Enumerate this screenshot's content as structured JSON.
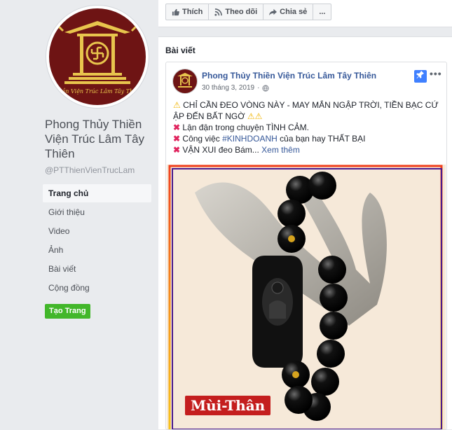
{
  "page": {
    "name": "Phong Thủy Thiền Viện Trúc Lâm Tây Thiên",
    "handle": "@PTThienVienTrucLam",
    "logo_text": "Thiền Viện Trúc Lâm Tây Thiên"
  },
  "nav": {
    "items": [
      {
        "label": "Trang chủ",
        "active": true
      },
      {
        "label": "Giới thiệu"
      },
      {
        "label": "Video"
      },
      {
        "label": "Ảnh"
      },
      {
        "label": "Bài viết"
      },
      {
        "label": "Cộng đồng"
      }
    ],
    "create_page_label": "Tạo Trang"
  },
  "actions": {
    "like": "Thích",
    "follow": "Theo dõi",
    "share": "Chia sẻ",
    "more": "..."
  },
  "posts_section": {
    "title": "Bài viết"
  },
  "post": {
    "author": "Phong Thủy Thiền Viện Trúc Lâm Tây Thiên",
    "date": "30 tháng 3, 2019",
    "line1": "CHỈ CẦN ĐEO VÒNG NÀY - MAY MẮN NGẬP TRỜI, TIỀN BẠC CỨ ẬP ĐẾN BẤT NGỜ",
    "line2": "Lận đận trong chuyện TÌNH CẢM.",
    "line3_prefix": "Công việc",
    "line3_tag": "#KINHDOANH",
    "line3_suffix": "của bạn hay THẤT BẠI",
    "line4": "VẬN XUI đeo Bám...",
    "see_more": "Xem thêm",
    "image_label": "Mùi-Thân"
  },
  "colors": {
    "brand_blue": "#365899",
    "logo_bg": "#6e1414",
    "logo_gold": "#e8c54d",
    "create_green": "#42b72a"
  }
}
